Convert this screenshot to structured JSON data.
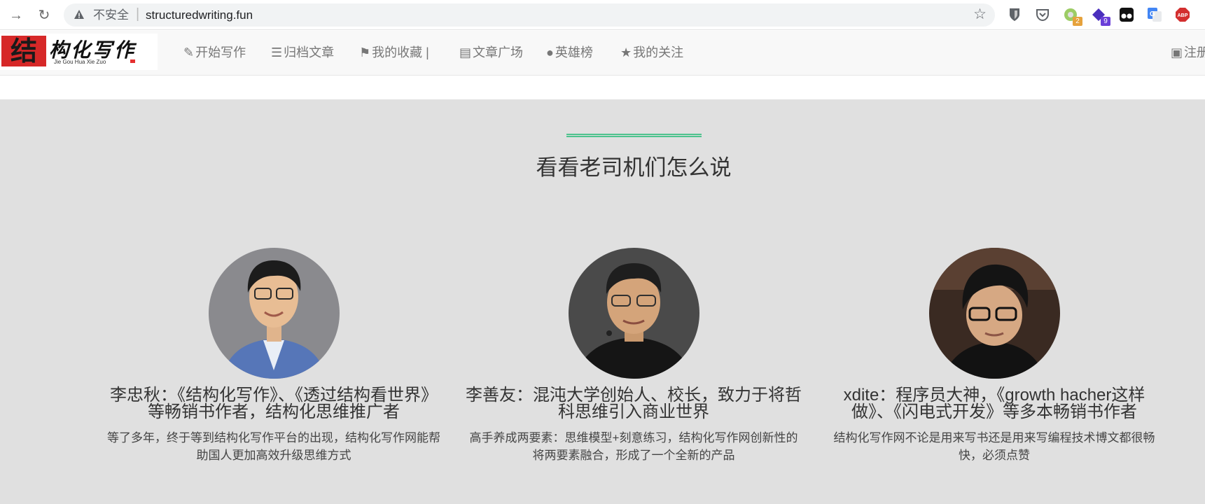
{
  "browser": {
    "insecure_label": "不安全",
    "separator": "|",
    "url": "structuredwriting.fun",
    "extensions": [
      {
        "name": "bitwarden",
        "badge": ""
      },
      {
        "name": "pocket",
        "badge": ""
      },
      {
        "name": "ext-green",
        "badge": "2"
      },
      {
        "name": "ext-purple",
        "badge": "9"
      },
      {
        "name": "tampermonkey",
        "badge": ""
      },
      {
        "name": "google-translate",
        "badge": ""
      },
      {
        "name": "adblock-plus",
        "badge": "",
        "text": "ABP"
      }
    ]
  },
  "site": {
    "logo_text": "结构化写作",
    "logo_seal": "结",
    "logo_brand": "构化写作",
    "logo_pinyin": "Jie Gou Hua Xie Zuo",
    "nav": [
      {
        "icon": "✎",
        "label": "开始写作"
      },
      {
        "icon": "☰",
        "label": "归档文章"
      },
      {
        "icon": "⚑",
        "label": "我的收藏 |"
      },
      {
        "icon": "▤",
        "label": "文章广场"
      },
      {
        "icon": "●",
        "label": "英雄榜"
      },
      {
        "icon": "★",
        "label": "我的关注"
      },
      {
        "icon": "▣",
        "label": "注册"
      }
    ]
  },
  "section": {
    "heading": "看看老司机们怎么说",
    "accent_color": "#4ec38e",
    "testimonials": [
      {
        "title": "李忠秋：《结构化写作》、《透过结构看世界》等畅销书作者，结构化思维推广者",
        "text": "等了多年，终于等到结构化写作平台的出现，结构化写作网能帮助国人更加高效升级思维方式"
      },
      {
        "title": "李善友：混沌大学创始人、校长，致力于将哲科思维引入商业世界",
        "text": "高手养成两要素：思维模型+刻意练习，结构化写作网创新性的将两要素融合，形成了一个全新的产品"
      },
      {
        "title": "xdite：程序员大神，《growth hacher这样做》、《闪电式开发》等多本畅销书作者",
        "text": "结构化写作网不论是用来写书还是用来写编程技术博文都很畅快，必须点赞"
      }
    ]
  }
}
